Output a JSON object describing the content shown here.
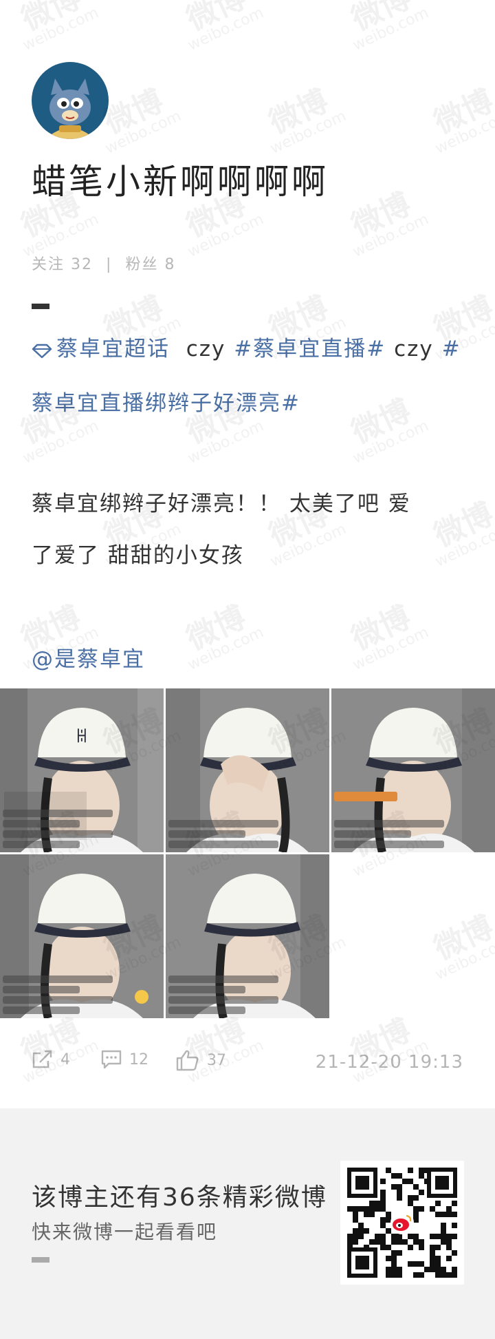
{
  "profile": {
    "username": "蜡笔小新啊啊啊啊",
    "stats": {
      "following_label": "关注",
      "following_count": "32",
      "separator": "|",
      "followers_label": "粉丝",
      "followers_count": "8"
    }
  },
  "post": {
    "super_topic": "蔡卓宜超话",
    "line1_text": "czy",
    "hashtag1": "#蔡卓宜直播#",
    "line1_text_b": "czy",
    "hashtag2_start": "#",
    "hashtag2_rest": "蔡卓宜直播绑辫子好漂亮#",
    "body_line1": "蔡卓宜绑辫子好漂亮！！ 太美了吧 爱",
    "body_line2": "了爱了 甜甜的小女孩",
    "mention": "@是蔡卓宜",
    "images_count": 5,
    "actions": {
      "repost_count": "4",
      "comment_count": "12",
      "like_count": "37",
      "timestamp": "21-12-20 19:13"
    }
  },
  "footer": {
    "title": "该博主还有36条精彩微博",
    "subtitle": "快来微博一起看看吧"
  },
  "watermark": {
    "text_cn": "微博",
    "text_en": "weibo.com"
  },
  "icons": [
    "repost-icon",
    "comment-icon",
    "like-icon",
    "diamond-icon",
    "qr-code",
    "weibo-logo-icon"
  ],
  "colors": {
    "link": "#4a6fa5",
    "text": "#333333",
    "meta": "#b5b5b5",
    "footer_bg": "#f2f2f2",
    "avatar_bg": "#1f5c83"
  }
}
